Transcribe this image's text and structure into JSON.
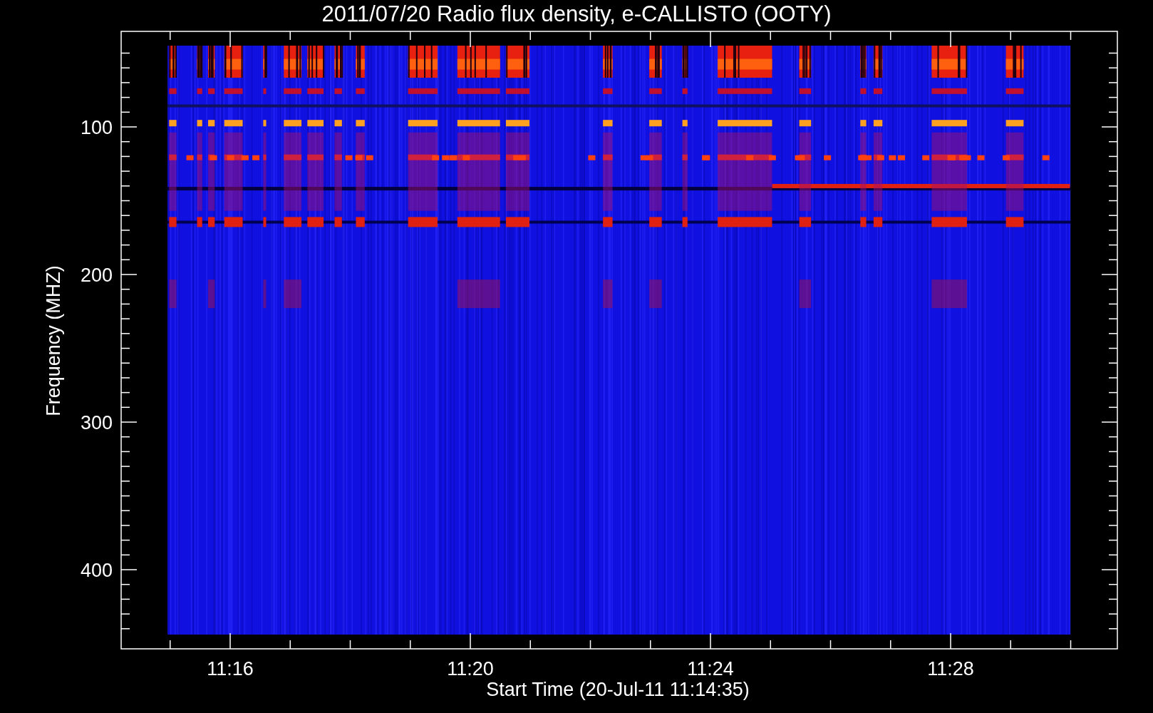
{
  "title": "2011/07/20  Radio flux density, e-CALLISTO (OOTY)",
  "y_axis": {
    "label": "Frequency (MHZ)",
    "ticks": [
      "100",
      "200",
      "300",
      "400"
    ]
  },
  "x_axis": {
    "label": "Start Time (20-Jul-11 11:14:35)",
    "ticks": [
      "11:16",
      "11:20",
      "11:24",
      "11:28"
    ]
  }
}
